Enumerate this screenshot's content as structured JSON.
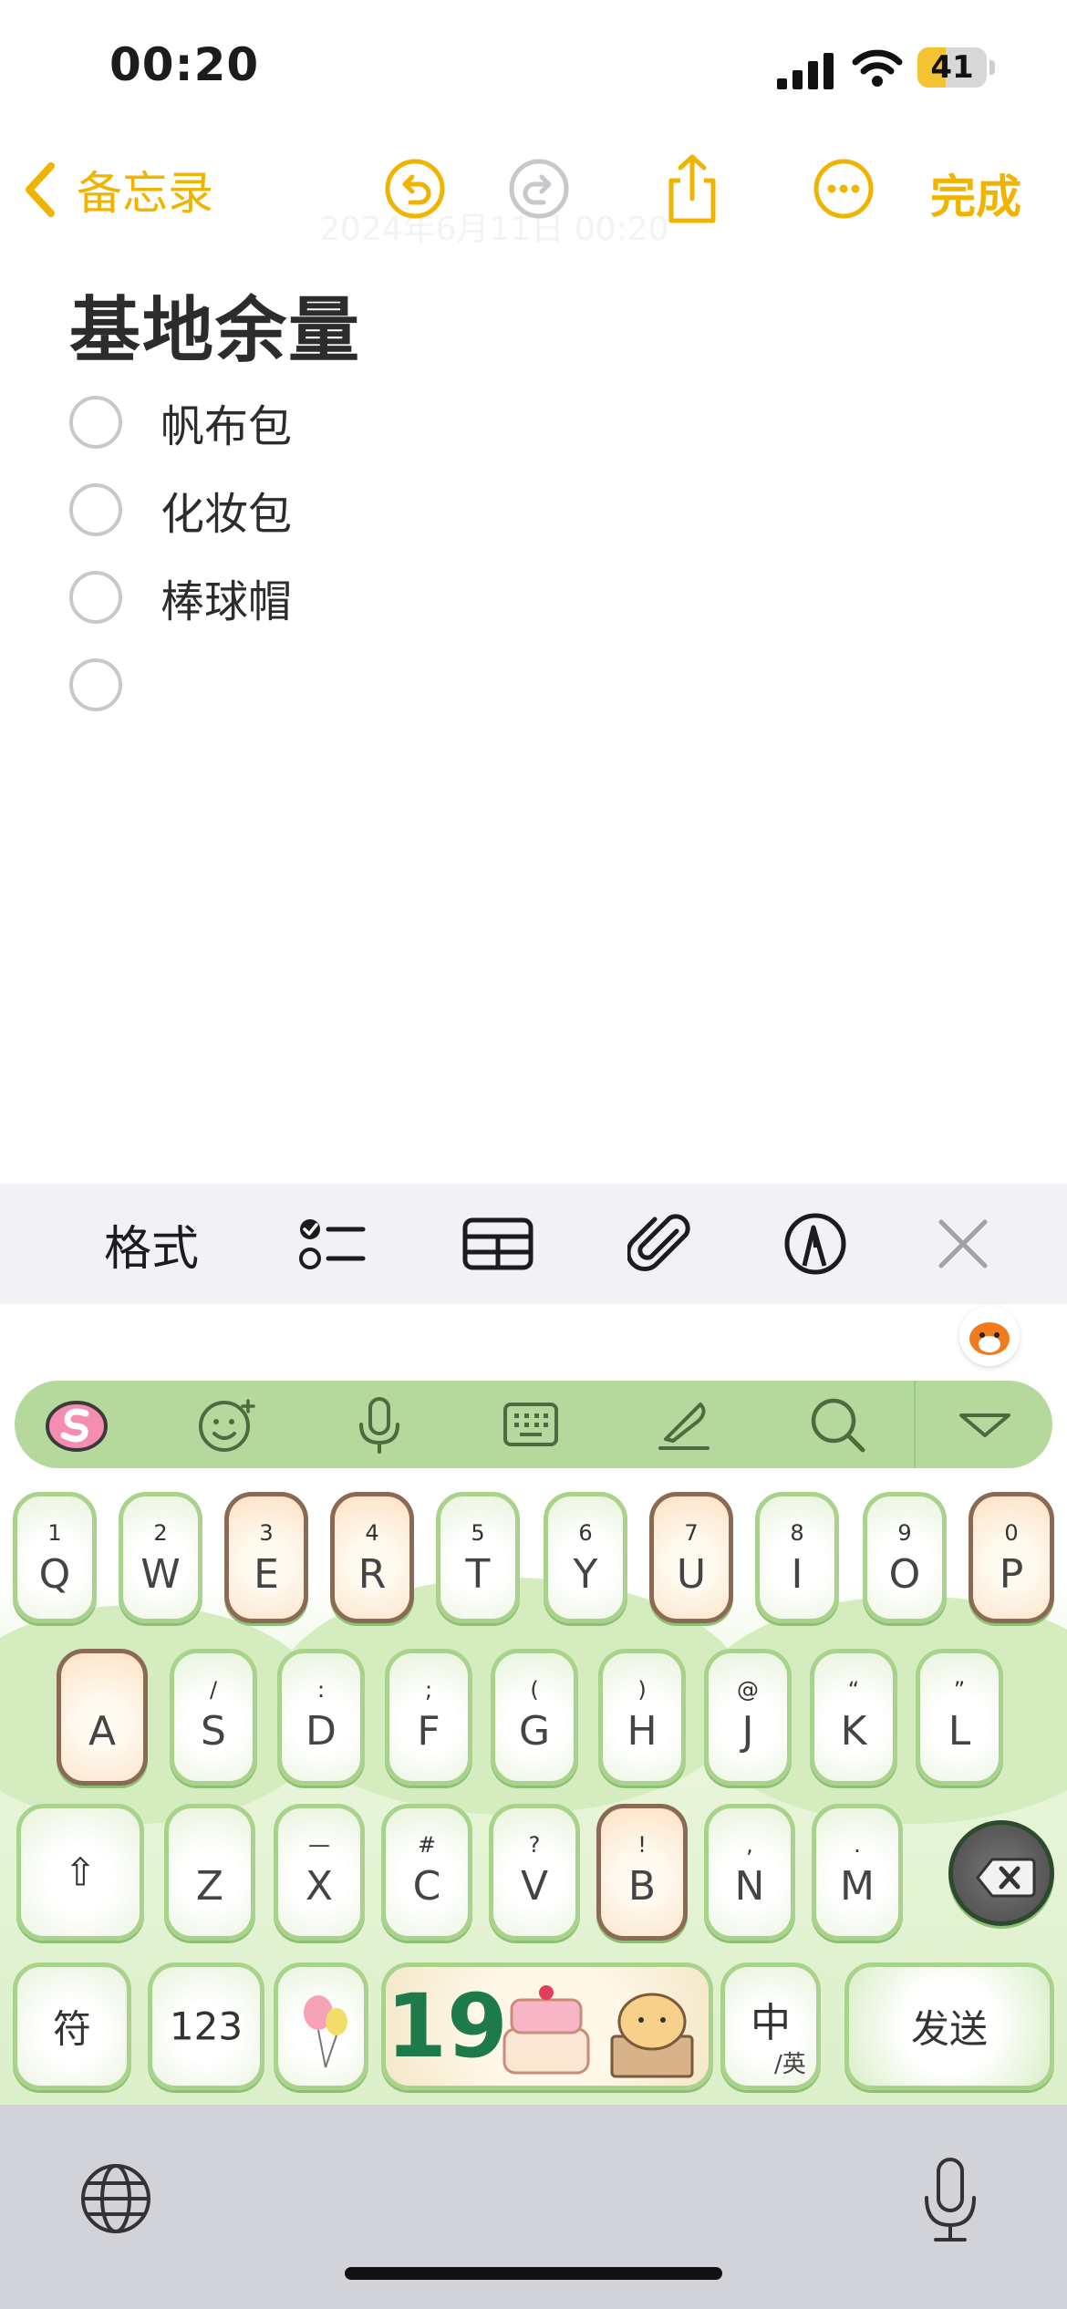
{
  "status_bar": {
    "time": "00:20",
    "battery_level": "41",
    "battery_fraction": 0.41
  },
  "nav": {
    "back_label": "备忘录",
    "faint_date": "2024年6月11日 00:20",
    "done_label": "完成",
    "accent_color": "#f0b400",
    "icons": [
      "undo-icon",
      "redo-icon",
      "share-icon",
      "more-icon"
    ]
  },
  "note": {
    "title": "基地余量",
    "checklist": [
      {
        "label": "帆布包",
        "checked": false
      },
      {
        "label": "化妆包",
        "checked": false
      },
      {
        "label": "棒球帽",
        "checked": false
      },
      {
        "label": "",
        "checked": false
      }
    ]
  },
  "format_toolbar": {
    "format_label": "格式",
    "icons": [
      "checklist-icon",
      "table-icon",
      "attachment-icon",
      "markup-icon",
      "close-icon"
    ]
  },
  "keyboard": {
    "toolbar_icons": [
      "sogou-logo-icon",
      "emoji-icon",
      "microphone-icon",
      "keyboard-icon",
      "handwriting-icon",
      "search-icon",
      "collapse-icon"
    ],
    "row1": [
      {
        "letter": "Q",
        "sym": "1"
      },
      {
        "letter": "W",
        "sym": "2"
      },
      {
        "letter": "E",
        "sym": "3"
      },
      {
        "letter": "R",
        "sym": "4"
      },
      {
        "letter": "T",
        "sym": "5"
      },
      {
        "letter": "Y",
        "sym": "6"
      },
      {
        "letter": "U",
        "sym": "7"
      },
      {
        "letter": "I",
        "sym": "8"
      },
      {
        "letter": "O",
        "sym": "9"
      },
      {
        "letter": "P",
        "sym": "0"
      }
    ],
    "row2": [
      {
        "letter": "A",
        "sym": ""
      },
      {
        "letter": "S",
        "sym": "/"
      },
      {
        "letter": "D",
        "sym": ":"
      },
      {
        "letter": "F",
        "sym": ";"
      },
      {
        "letter": "G",
        "sym": "("
      },
      {
        "letter": "H",
        "sym": ")"
      },
      {
        "letter": "J",
        "sym": "@"
      },
      {
        "letter": "K",
        "sym": "“"
      },
      {
        "letter": "L",
        "sym": "”"
      }
    ],
    "row3": [
      {
        "letter": "Z",
        "sym": ""
      },
      {
        "letter": "X",
        "sym": "—"
      },
      {
        "letter": "C",
        "sym": "#"
      },
      {
        "letter": "V",
        "sym": "?"
      },
      {
        "letter": "B",
        "sym": "!"
      },
      {
        "letter": "N",
        "sym": ","
      },
      {
        "letter": "M",
        "sym": "."
      }
    ],
    "shift_label": "⇧",
    "symbols_label": "符",
    "numbers_label": "123",
    "space_label": "19",
    "lang_label": "中",
    "lang_sub_label": "/英",
    "send_label": "发送"
  },
  "system": {
    "icons": [
      "globe-icon",
      "dictation-mic-icon"
    ]
  }
}
